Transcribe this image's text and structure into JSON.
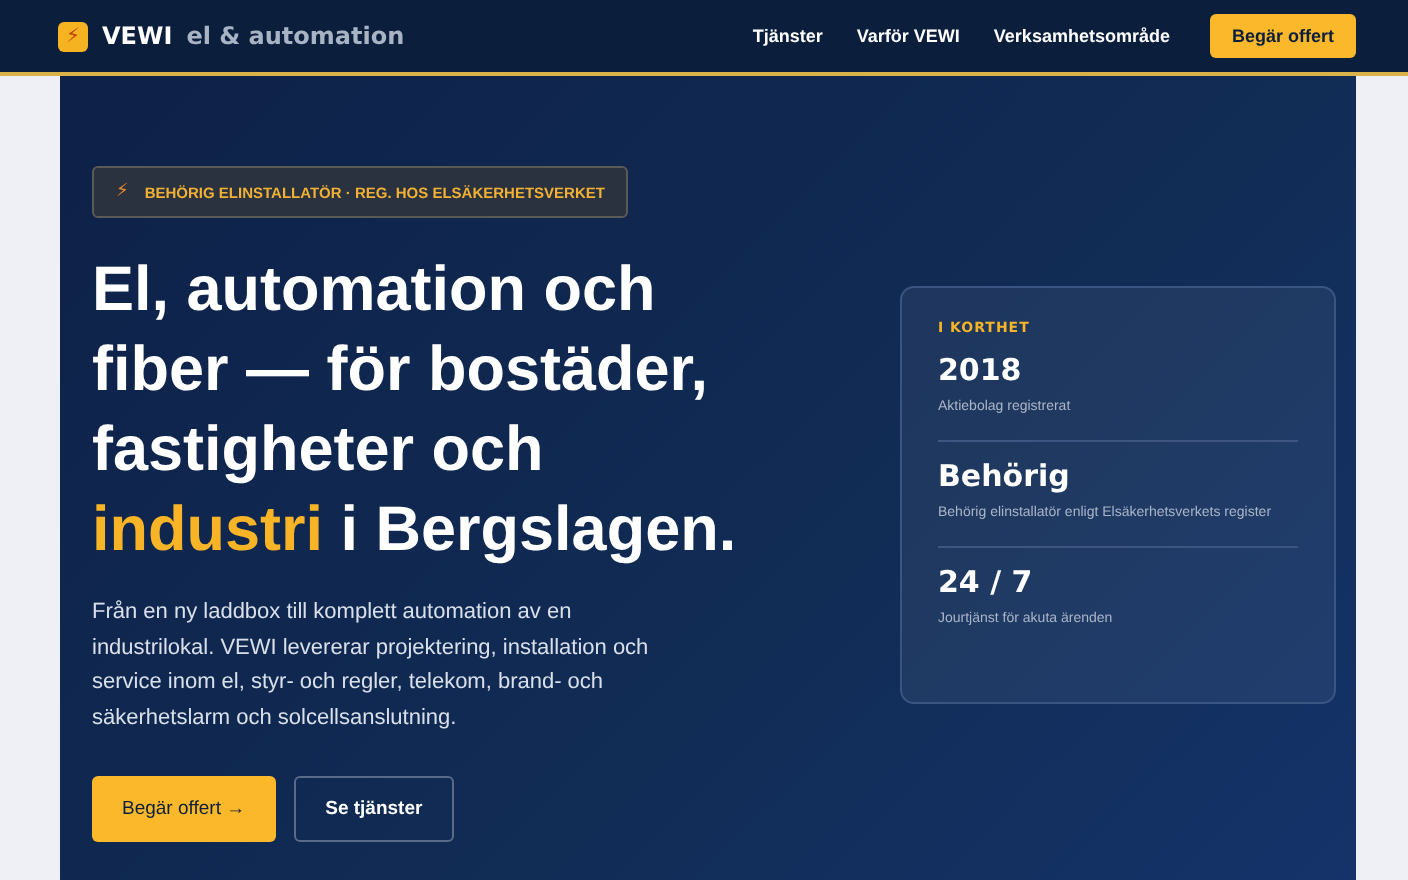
{
  "header": {
    "logo_icon": "⚡",
    "brand": "VEWI",
    "tagline": "el & automation",
    "nav": [
      {
        "label": "Tjänster"
      },
      {
        "label": "Varför VEWI"
      },
      {
        "label": "Verksamhetsområde"
      }
    ],
    "cta": "Begär offert"
  },
  "hero": {
    "badge": {
      "icon": "⚡",
      "text": "BEHÖRIG ELINSTALLATÖR · REG. HOS ELSÄKERHETSVERKET"
    },
    "heading": [
      {
        "text": "El, automation och fiber — för bostäder, fastigheter och",
        "accent": false
      },
      {
        "text": "industri",
        "accent": true
      },
      {
        "text": "i Bergslagen.",
        "accent": false
      }
    ],
    "lead": "Från en ny laddbox till komplett automation av en industrilokal. VEWI levererar projektering, installation och service inom el, styr- och regler, telekom, brand- och säkerhetslarm och solcellsanslutning.",
    "buttons": [
      {
        "label": "Begär offert →",
        "kind": "primary"
      },
      {
        "label": "Se tjänster",
        "kind": "outline"
      }
    ]
  },
  "facts": {
    "title": "I KORTHET",
    "items": [
      {
        "value": "2018",
        "caption": "Aktiebolag registrerat"
      },
      {
        "value": "Behörig",
        "caption": "Behörig elinstallatör enligt Elsäkerhetsverkets register"
      },
      {
        "value": "24 / 7",
        "caption": "Jourtjänst för akuta ärenden"
      }
    ]
  }
}
